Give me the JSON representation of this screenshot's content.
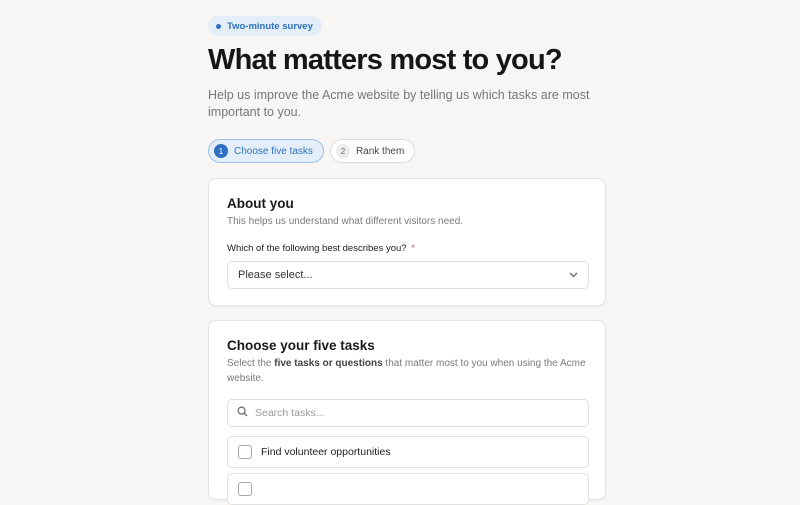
{
  "header": {
    "badge": "Two-minute survey",
    "title": "What matters most to you?",
    "lead": "Help us improve the Acme website by telling us which tasks are most important to you."
  },
  "steps": [
    {
      "number": "1",
      "label": "Choose five tasks",
      "active": true
    },
    {
      "number": "2",
      "label": "Rank them",
      "active": false
    }
  ],
  "about": {
    "title": "About you",
    "description": "This helps us understand what different visitors need.",
    "question": "Which of the following best describes you?",
    "required_mark": "*",
    "select_value": "Please select..."
  },
  "tasks": {
    "title": "Choose your five tasks",
    "description_pre": "Select the ",
    "description_bold": "five tasks or questions",
    "description_post": " that matter most to you when using the Acme website.",
    "search_placeholder": "Search tasks...",
    "items": [
      {
        "label": "Find volunteer opportunities",
        "checked": false
      },
      {
        "label": "",
        "checked": false
      }
    ]
  },
  "colors": {
    "accent": "#2f6fbf",
    "badge_bg": "#e4eef9",
    "page_bg": "#f7f6f4"
  },
  "icons": {
    "search": "search-icon",
    "select": "chevron-down-icon"
  }
}
